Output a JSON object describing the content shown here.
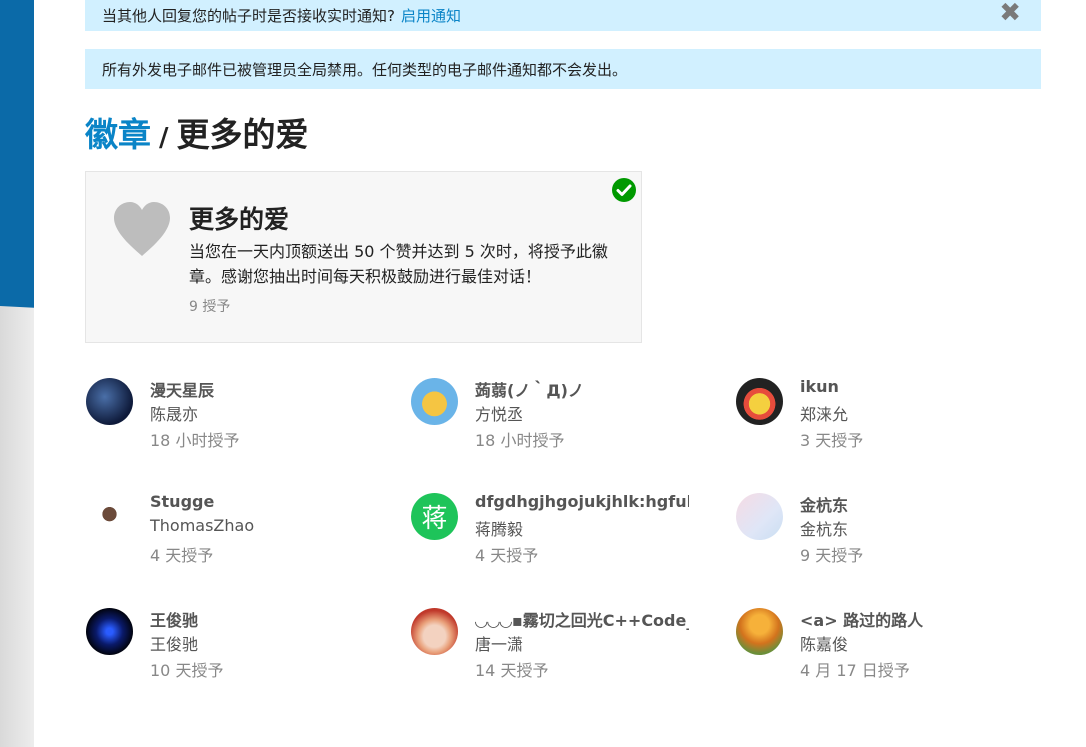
{
  "notify_banner": {
    "text": "当其他人回复您的帖子时是否接收实时通知?",
    "link": "启用通知",
    "close_glyph": "✖"
  },
  "mail_banner": {
    "text": "所有外发电子邮件已被管理员全局禁用。任何类型的电子邮件通知都不会发出。"
  },
  "breadcrumb": {
    "root": "徽章",
    "separator": "/",
    "current": "更多的爱"
  },
  "badge": {
    "icon": "heart-icon",
    "status_icon": "check-circle-icon",
    "title": "更多的爱",
    "description": "当您在一天内顶额送出 50 个赞并达到 5 次时，将授予此徽章。感谢您抽出时间每天积极鼓励进行最佳对话！",
    "grant_count": "9 授予"
  },
  "grantees": [
    {
      "username": "漫天星辰",
      "name": "陈晟亦",
      "granted": "18 小时授予"
    },
    {
      "username": "蒟蒻(ノ｀Д)ノ",
      "name": "方悦丞",
      "granted": "18 小时授予"
    },
    {
      "username": "ikun",
      "name": "郑涞允",
      "granted": "3 天授予"
    },
    {
      "username": "Stugge",
      "name": "ThomasZhao",
      "granted": "4 天授予"
    },
    {
      "username": "dfgdhgjhgojukjhlk:hgfuhgg",
      "name": "蒋腾毅",
      "granted": "4 天授予",
      "avatar_letter": "蒋"
    },
    {
      "username": "金杭东",
      "name": "金杭东",
      "granted": "9 天授予"
    },
    {
      "username": "王俊驰",
      "name": "王俊驰",
      "granted": "10 天授予"
    },
    {
      "username": "◡◡◡▪霧切之回光C++Code_l",
      "name": "唐一潇",
      "granted": "14 天授予"
    },
    {
      "username": "<a> 路过的路人",
      "name": "陈嘉俊",
      "granted": "4 月 17 日授予"
    }
  ],
  "colors": {
    "accent": "#0a84c7",
    "banner_bg": "#d1f0ff",
    "check_green": "#009900",
    "heart_grey": "#bdbdbd",
    "avatar_green": "#1ec45a"
  }
}
